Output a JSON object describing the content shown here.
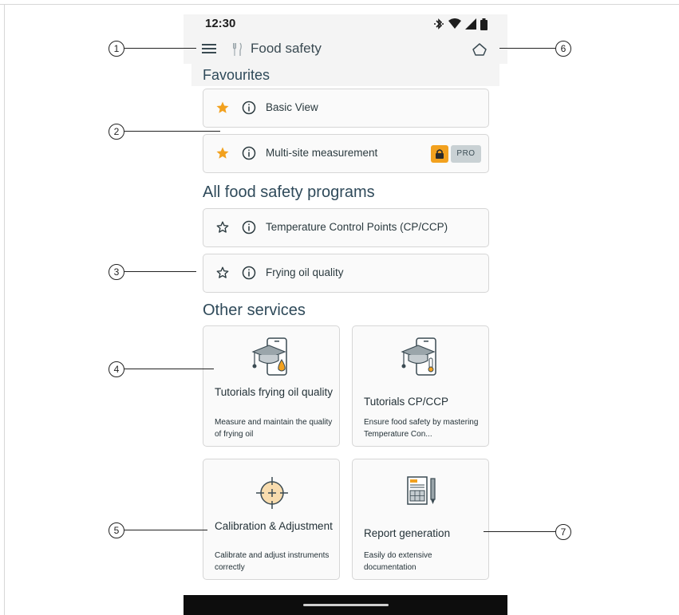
{
  "status_bar": {
    "time": "12:30",
    "icons": [
      "bluetooth-icon",
      "wifi-icon",
      "signal-icon",
      "battery-icon"
    ]
  },
  "app_bar": {
    "title": "Food safety",
    "menu_icon": "hamburger-menu-icon",
    "app_icon": "fork-knife-icon",
    "home_icon": "home-icon"
  },
  "favourites": {
    "heading": "Favourites",
    "items": [
      {
        "label": "Basic View",
        "starred": true
      },
      {
        "label": "Multi-site measurement",
        "starred": true,
        "locked": true,
        "badge": "PRO"
      }
    ]
  },
  "programs": {
    "heading": "All food safety programs",
    "items": [
      {
        "label": "Temperature Control Points (CP/CCP)",
        "starred": false
      },
      {
        "label": "Frying oil quality",
        "starred": false
      }
    ]
  },
  "services": {
    "heading": "Other services",
    "items": [
      {
        "title": "Tutorials frying oil quality",
        "description": "Measure and maintain the quality of frying oil",
        "icon": "phone-graduation-cap-oil-drop-icon"
      },
      {
        "title": "Tutorials CP/CCP",
        "description": "Ensure food safety by mastering Temperature Con...",
        "icon": "phone-graduation-cap-thermometer-icon"
      },
      {
        "title": "Calibration & Adjustment",
        "description": "Calibrate and adjust instruments correctly",
        "icon": "crosshair-target-icon"
      },
      {
        "title": "Report generation",
        "description": "Easily do extensive documentation",
        "icon": "report-document-pen-icon"
      }
    ]
  },
  "callouts": [
    "1",
    "2",
    "3",
    "4",
    "5",
    "6",
    "7"
  ],
  "colors": {
    "accent_star": "#f2a11e",
    "lock_badge": "#f2a11e",
    "heading": "#2f4a5a",
    "card_border": "#d6d6d6",
    "nav_bar": "#0d0d0d"
  }
}
